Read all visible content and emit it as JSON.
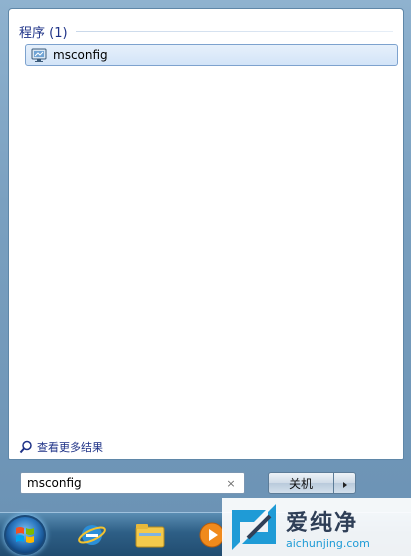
{
  "results": {
    "group_title": "程序 (1)",
    "items": [
      {
        "label": "msconfig",
        "icon": "msconfig-program-icon"
      }
    ],
    "see_more": {
      "label": "查看更多结果",
      "icon": "magnifier-icon"
    }
  },
  "search": {
    "value": "msconfig",
    "clear_glyph": "×"
  },
  "shutdown": {
    "label": "关机",
    "arrow_icon": "triangle-right-icon"
  },
  "taskbar": {
    "items": [
      "start-orb",
      "internet-explorer-icon",
      "file-explorer-icon",
      "media-player-icon"
    ]
  },
  "watermark": {
    "title": "爱纯净",
    "url": "aichunjing.com"
  },
  "colors": {
    "accent_text": "#1e3287",
    "selection_border": "#7da2ce",
    "frame": "#7aa0c0",
    "watermark_url": "#1f9bd6"
  }
}
